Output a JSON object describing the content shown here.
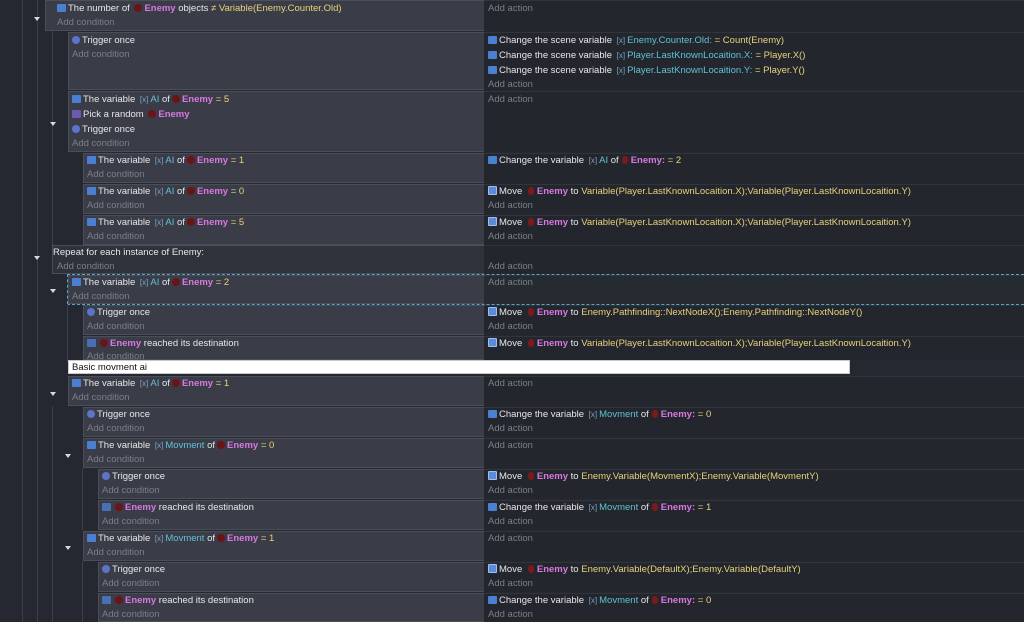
{
  "labels": {
    "add_condition": "Add condition",
    "add_action": "Add action",
    "trigger_once": "Trigger once",
    "the_variable": "The variable",
    "of": "of",
    "pick_random": "Pick a random",
    "change_scene_var": "Change the scene variable",
    "change_var": "Change the variable",
    "move": "Move",
    "to": "to",
    "reached": "reached its destination",
    "the_number_of": "The number of",
    "objects": "objects"
  },
  "names": {
    "enemy": "Enemy",
    "enemy_colon": "Enemy:",
    "ai": "AI",
    "movment": "Movment",
    "counter_old": "Enemy.Counter.Old:",
    "last_x": "Player.LastKnownLocaition.X:",
    "last_y": "Player.LastKnownLocaition.Y:"
  },
  "exprs": {
    "neq_counter": "≠ Variable(Enemy.Counter.Old)",
    "eq_count": "= Count(Enemy)",
    "eq_px": "= Player.X()",
    "eq_py": "= Player.Y()",
    "eq5": "= 5",
    "eq1": "= 1",
    "eq0": "= 0",
    "eq2": "= 2",
    "set2": "= 2",
    "set0": "= 0",
    "set1": "= 1",
    "to_last": "Variable(Player.LastKnownLocaition.X);Variable(Player.LastKnownLocaition.Y)",
    "to_path": "Enemy.Pathfinding::NextNodeX();Enemy.Pathfinding::NextNodeY()",
    "to_mov": "Enemy.Variable(MovmentX);Enemy.Variable(MovmentY)",
    "to_def": "Enemy.Variable(DefaultX);Enemy.Variable(DefaultY)"
  },
  "repeat_label": "Repeat for each instance of Enemy:",
  "comment": "Basic movment ai",
  "colors": {
    "object": "#d878e0",
    "variable": "#5fc2d6",
    "expression": "#e8d27c",
    "background": "#252830"
  },
  "icons": [
    "variable-icon",
    "trigger-once-icon",
    "move-icon",
    "pick-random-icon",
    "destination-icon",
    "enemy-sprite-icon",
    "collapse-chevron-icon"
  ]
}
